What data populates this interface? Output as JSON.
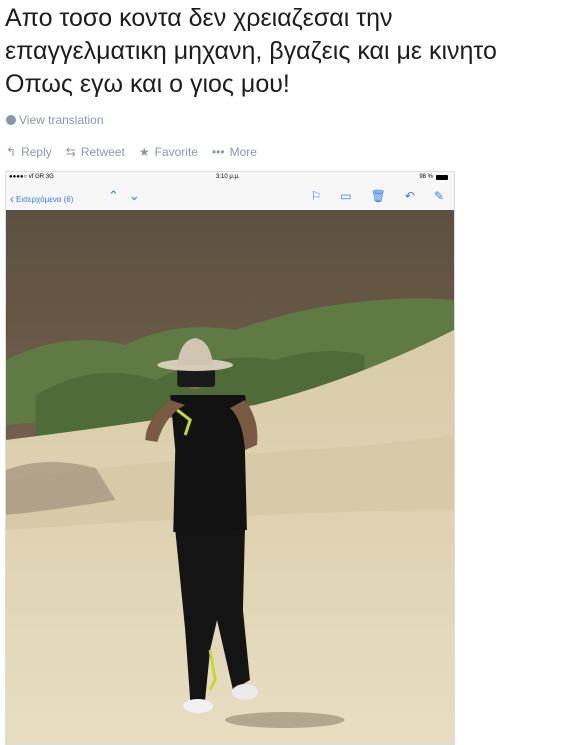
{
  "tweet": {
    "lines": [
      "Απο τοσο κοντα δεν χρειαζεσαι την",
      "επαγγελματικη μηχανη, βγαζεις και με κινητο",
      "Οπως εγω και ο γιος μου!"
    ],
    "translate_label": "View translation"
  },
  "actions": {
    "reply": "Reply",
    "retweet": "Retweet",
    "favorite": "Favorite",
    "more": "More"
  },
  "phone": {
    "carrier": "●●●●○ vf GR  3G",
    "time": "3:10 μ.μ.",
    "battery": "98 %",
    "back_label": "Εισερχόμενα (6)"
  },
  "colors": {
    "accent": "#2f7cf6",
    "meta": "#8899a6"
  },
  "icons": [
    "globe-icon",
    "reply-icon",
    "retweet-icon",
    "star-icon",
    "ellipsis-icon",
    "chevron-left-icon",
    "chevron-up-icon",
    "chevron-down-icon",
    "flag-icon",
    "folder-icon",
    "trash-icon",
    "reply-all-icon",
    "compose-icon"
  ]
}
